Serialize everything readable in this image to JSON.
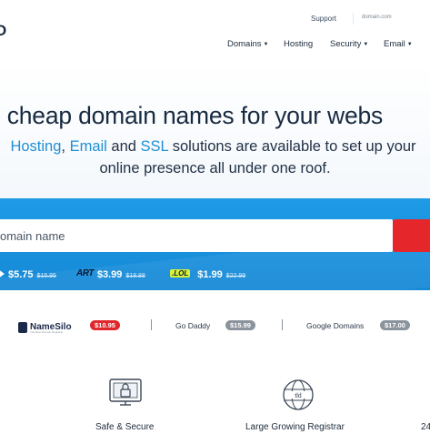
{
  "header": {
    "logo_text": "O",
    "support_label": "Support",
    "search_placeholder": "domain.com",
    "nav": [
      {
        "label": "Domains",
        "dropdown": true
      },
      {
        "label": "Hosting",
        "dropdown": false
      },
      {
        "label": "Security",
        "dropdown": true
      },
      {
        "label": "Email",
        "dropdown": true
      }
    ]
  },
  "hero": {
    "title": "d cheap domain names for your webs",
    "sub_hosting": "Hosting",
    "sub_comma": ", ",
    "sub_email": "Email",
    "sub_and": " and ",
    "sub_ssl": "SSL",
    "sub_rest": " solutions are available to set up your",
    "sub_line2": "online presence all under one roof."
  },
  "search": {
    "placeholder": "omain name",
    "button_color": "#e5262b"
  },
  "tlds": [
    {
      "icon": "arrow-icon",
      "price": "$5.75",
      "old_price": "$15.95"
    },
    {
      "icon": "art-logo",
      "logo": "ART",
      "price": "$3.99",
      "old_price": "$18.88"
    },
    {
      "icon": "lol-logo",
      "logo": ".LOL",
      "price": "$1.99",
      "old_price": "$22.99"
    }
  ],
  "comparison": {
    "namesilo": {
      "name": "NameSilo",
      "tagline": "The Best Domain Registrar",
      "price": "$10.95"
    },
    "godaddy": {
      "name": "Go Daddy",
      "price": "$15.99"
    },
    "google": {
      "name": "Google Domains",
      "price": "$17.00"
    }
  },
  "features": [
    {
      "icon": "lock-monitor-icon",
      "label": "Safe & Secure"
    },
    {
      "icon": "globe-icon",
      "label": "Large Growing Registrar",
      "globe_text": "tld"
    },
    {
      "icon": "support-icon",
      "label": "24"
    }
  ],
  "colors": {
    "accent": "#1f8fd6",
    "band": "#1e9be6",
    "cta": "#e5262b",
    "dark_text": "#172a40"
  }
}
